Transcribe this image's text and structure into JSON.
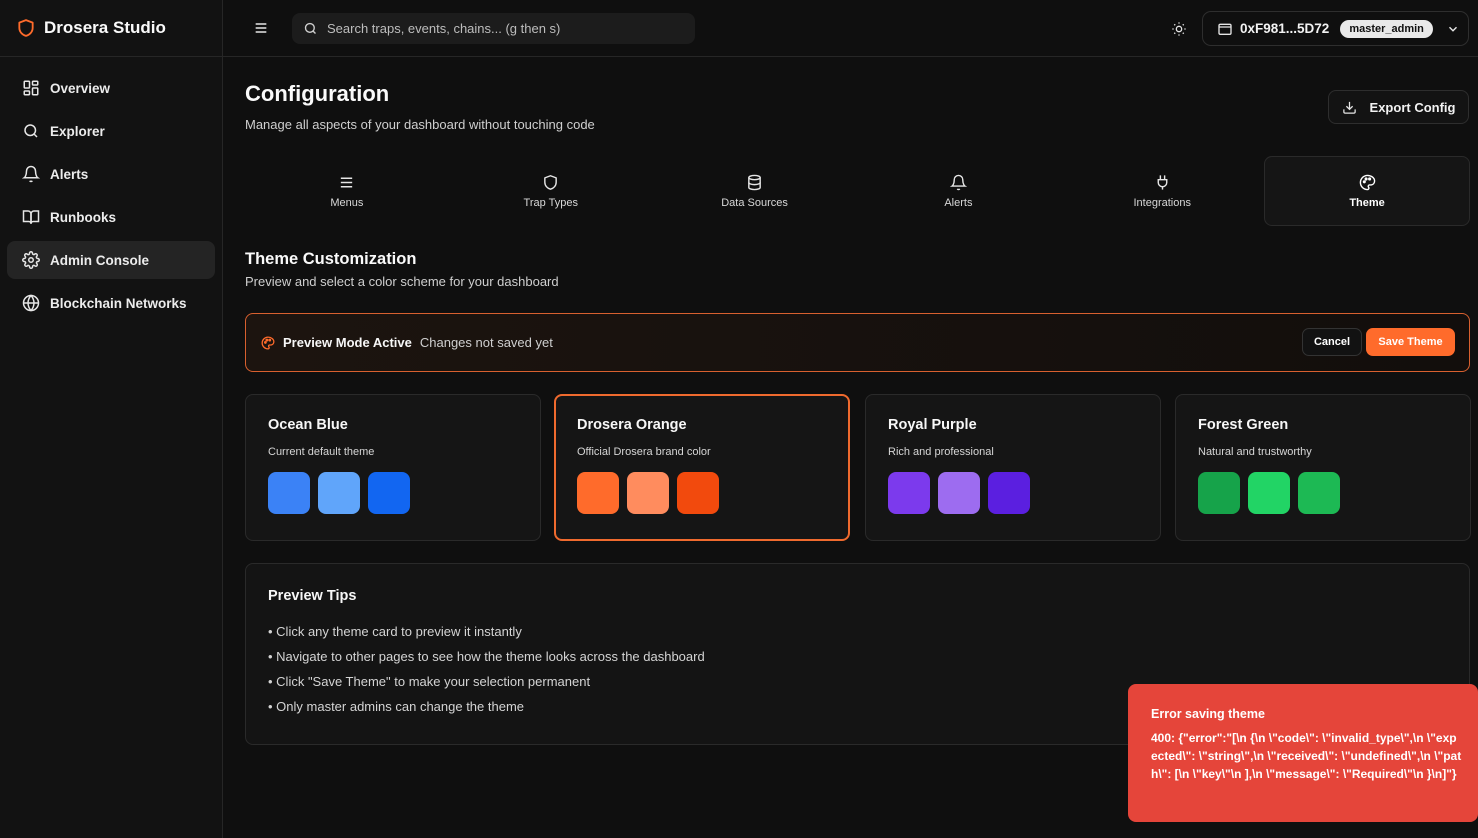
{
  "brand": {
    "name": "Drosera Studio"
  },
  "sidebar": {
    "items": [
      {
        "label": "Overview",
        "icon": "layout-grid-icon"
      },
      {
        "label": "Explorer",
        "icon": "search-icon"
      },
      {
        "label": "Alerts",
        "icon": "bell-icon"
      },
      {
        "label": "Runbooks",
        "icon": "book-icon"
      },
      {
        "label": "Admin Console",
        "icon": "gear-icon",
        "active": true
      },
      {
        "label": "Blockchain Networks",
        "icon": "globe-icon"
      }
    ]
  },
  "topbar": {
    "search_placeholder": "Search traps, events, chains... (g then s)",
    "wallet_address": "0xF981...5D72",
    "role": "master_admin"
  },
  "page": {
    "title": "Configuration",
    "subtitle": "Manage all aspects of your dashboard without touching code",
    "export_label": "Export Config"
  },
  "tabs": [
    {
      "label": "Menus",
      "icon": "menu-icon"
    },
    {
      "label": "Trap Types",
      "icon": "shield-icon"
    },
    {
      "label": "Data Sources",
      "icon": "database-icon"
    },
    {
      "label": "Alerts",
      "icon": "bell-icon"
    },
    {
      "label": "Integrations",
      "icon": "plug-icon"
    },
    {
      "label": "Theme",
      "icon": "palette-icon",
      "active": true
    }
  ],
  "theme_section": {
    "title": "Theme Customization",
    "subtitle": "Preview and select a color scheme for your dashboard"
  },
  "preview_banner": {
    "title": "Preview Mode Active",
    "subtitle": "Changes not saved yet",
    "cancel_label": "Cancel",
    "save_label": "Save Theme"
  },
  "themes": [
    {
      "name": "Ocean Blue",
      "description": "Current default theme",
      "colors": [
        "#3b82f6",
        "#60a5fa",
        "#1266f1"
      ],
      "selected": false
    },
    {
      "name": "Drosera Orange",
      "description": "Official Drosera brand color",
      "colors": [
        "#ff6b2b",
        "#ff8c5e",
        "#f24a0d"
      ],
      "selected": true
    },
    {
      "name": "Royal Purple",
      "description": "Rich and professional",
      "colors": [
        "#7c3aed",
        "#9d6cf0",
        "#5b1fe0"
      ],
      "selected": false
    },
    {
      "name": "Forest Green",
      "description": "Natural and trustworthy",
      "colors": [
        "#16a34a",
        "#22d465",
        "#1db954"
      ],
      "selected": false
    }
  ],
  "tips": {
    "title": "Preview Tips",
    "items": [
      "• Click any theme card to preview it instantly",
      "• Navigate to other pages to see how the theme looks across the dashboard",
      "• Click \"Save Theme\" to make your selection permanent",
      "• Only master admins can change the theme"
    ]
  },
  "toast": {
    "title": "Error saving theme",
    "message": "400: {\"error\":\"[\\n {\\n \\\"code\\\": \\\"invalid_type\\\",\\n \\\"expected\\\": \\\"string\\\",\\n \\\"received\\\": \\\"undefined\\\",\\n \\\"path\\\": [\\n \\\"key\\\"\\n ],\\n \\\"message\\\": \\\"Required\\\"\\n }\\n]\"}"
  },
  "colors": {
    "accent": "#ff6b2b",
    "error": "#e5453a",
    "background": "#0f0f0f"
  }
}
